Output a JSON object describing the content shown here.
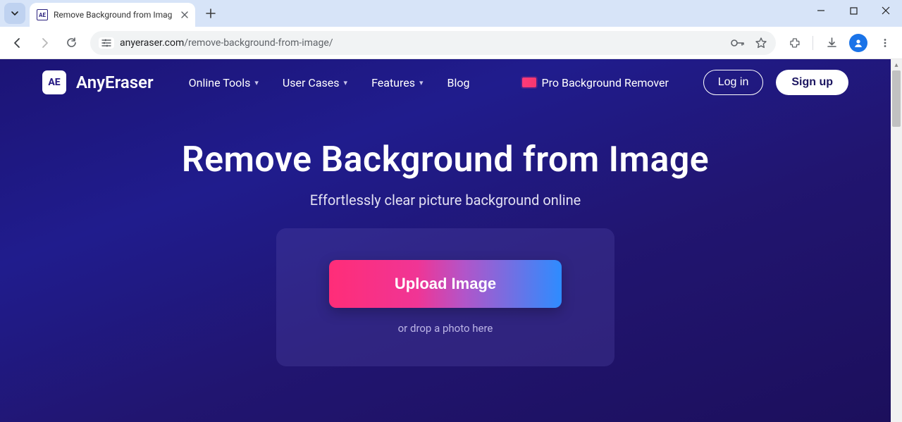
{
  "browser": {
    "tab": {
      "favicon_text": "AE",
      "title": "Remove Background from Imag"
    },
    "url_host": "anyeraser.com",
    "url_path": "/remove-background-from-image/"
  },
  "site": {
    "logo_short": "AE",
    "logo_name": "AnyEraser",
    "nav": {
      "online_tools": "Online Tools",
      "user_cases": "User Cases",
      "features": "Features",
      "blog": "Blog",
      "pro": "Pro Background Remover"
    },
    "auth": {
      "login": "Log in",
      "signup": "Sign up"
    }
  },
  "hero": {
    "title": "Remove Background from Image",
    "subtitle": "Effortlessly clear picture background online",
    "upload_label": "Upload Image",
    "drop_label": "or drop a photo here"
  }
}
